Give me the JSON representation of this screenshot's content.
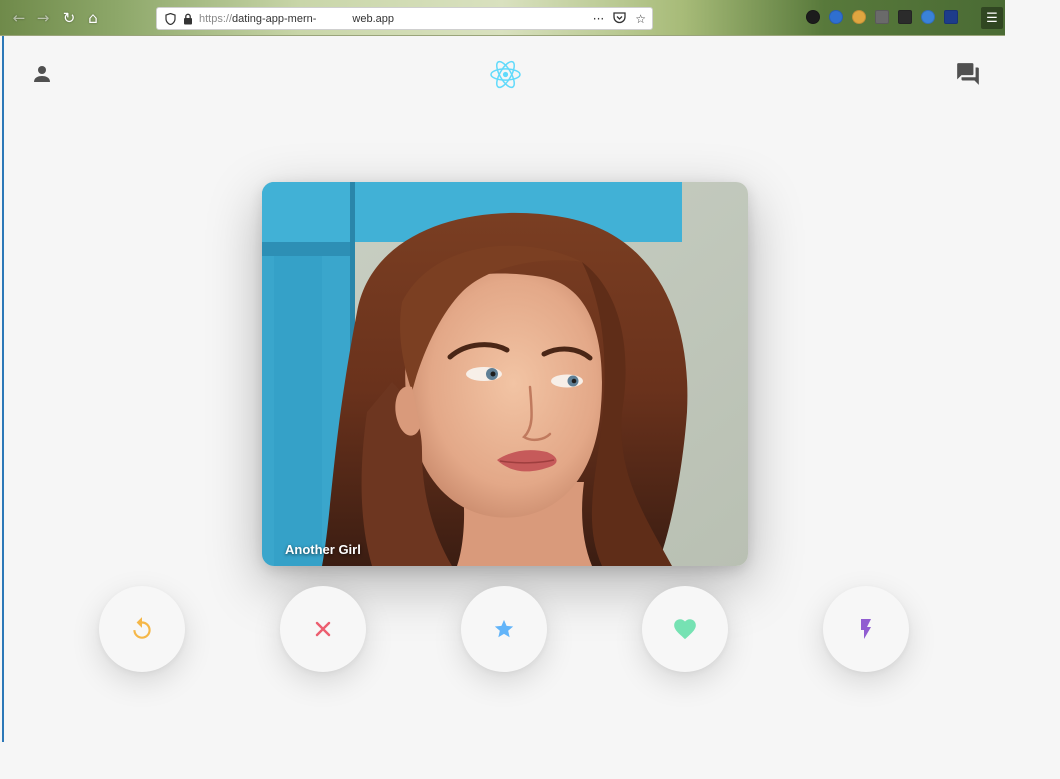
{
  "browser": {
    "url_scheme": "https://",
    "url_host_start": "dating-app-mern-",
    "url_host_end": "web.app",
    "url_menu_glyph": "···"
  },
  "header": {
    "profile_icon": "person-icon",
    "logo_icon": "react-logo",
    "chat_icon": "forum-icon"
  },
  "card": {
    "name": "Another Girl"
  },
  "swipe_buttons": [
    {
      "name": "replay",
      "icon": "replay-icon",
      "color": "#f5b748"
    },
    {
      "name": "close",
      "icon": "close-icon",
      "color": "#ec5e6f"
    },
    {
      "name": "star",
      "icon": "star-icon",
      "color": "#62b4f9"
    },
    {
      "name": "like",
      "icon": "favorite-icon",
      "color": "#76e2b3"
    },
    {
      "name": "boost",
      "icon": "flash-icon",
      "color": "#915dd1"
    }
  ],
  "colors": {
    "background": "#f6f6f6",
    "react_blue": "#61dafb",
    "header_icon": "#505050"
  }
}
